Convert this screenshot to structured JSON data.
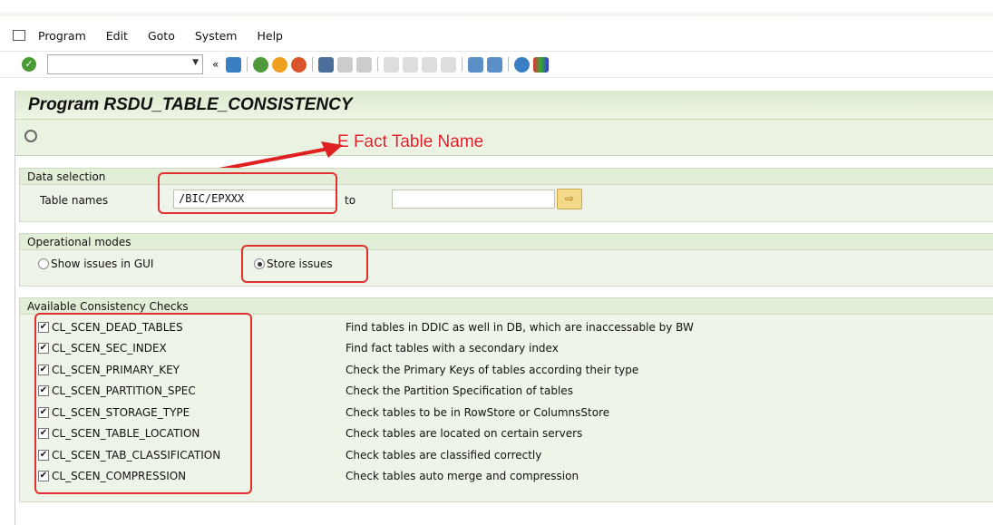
{
  "menu": [
    "Program",
    "Edit",
    "Goto",
    "System",
    "Help"
  ],
  "menu_access": [
    "P",
    "E",
    "G",
    "y",
    "H"
  ],
  "title": "Program RSDU_TABLE_CONSISTENCY",
  "annotation": "E Fact Table Name",
  "data_selection": {
    "header": "Data selection",
    "label": "Table names",
    "from": "/BIC/EPXXX",
    "to_label": "to",
    "to": ""
  },
  "modes": {
    "header": "Operational modes",
    "options": [
      {
        "label": "Show issues in GUI",
        "selected": false
      },
      {
        "label": "Store issues",
        "selected": true
      }
    ]
  },
  "checks": {
    "header": "Available Consistency Checks",
    "items": [
      {
        "name": "CL_SCEN_DEAD_TABLES",
        "desc": "Find tables in DDIC as well in DB, which are inaccessable by BW",
        "checked": true
      },
      {
        "name": "CL_SCEN_SEC_INDEX",
        "desc": "Find fact tables with a secondary index",
        "checked": true
      },
      {
        "name": "CL_SCEN_PRIMARY_KEY",
        "desc": "Check the Primary Keys of tables according their type",
        "checked": true
      },
      {
        "name": "CL_SCEN_PARTITION_SPEC",
        "desc": "Check the Partition Specification of tables",
        "checked": true
      },
      {
        "name": "CL_SCEN_STORAGE_TYPE",
        "desc": "Check tables to be in RowStore or ColumnsStore",
        "checked": true
      },
      {
        "name": "CL_SCEN_TABLE_LOCATION",
        "desc": "Check tables are located on certain servers",
        "checked": true
      },
      {
        "name": "CL_SCEN_TAB_CLASSIFICATION",
        "desc": "Check tables are classified correctly",
        "checked": true
      },
      {
        "name": "CL_SCEN_COMPRESSION",
        "desc": "Check tables auto merge and compression",
        "checked": true
      }
    ]
  },
  "colors": {
    "accent_red": "#e02020",
    "panel_green": "#eef5e8"
  }
}
